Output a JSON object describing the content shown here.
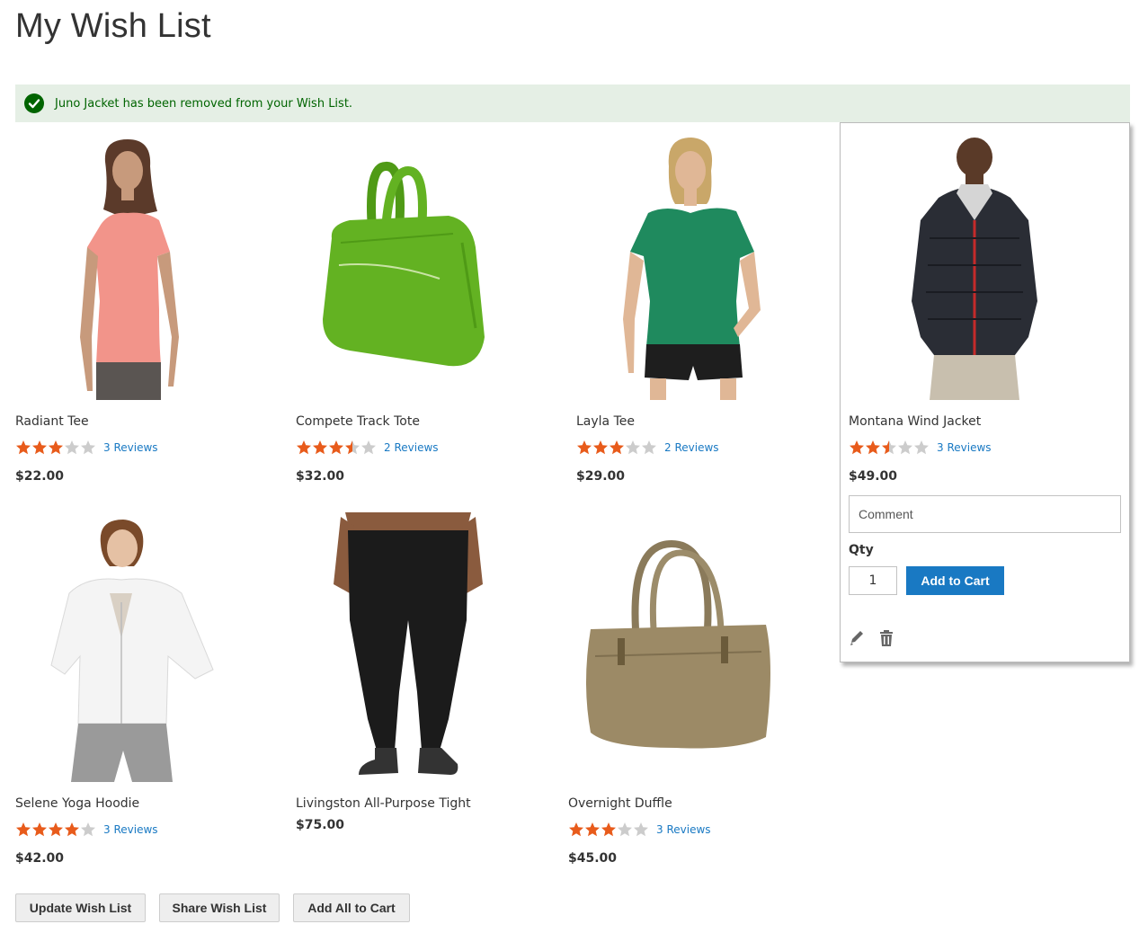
{
  "page_title": "My Wish List",
  "message": "Juno Jacket has been removed from your Wish List.",
  "products": [
    {
      "name": "Radiant Tee",
      "rating_stars": 3,
      "reviews": "3 Reviews",
      "price": "$22.00"
    },
    {
      "name": "Compete Track Tote",
      "rating_stars": 3.5,
      "reviews": "2 Reviews",
      "price": "$32.00"
    },
    {
      "name": "Layla Tee",
      "rating_stars": 3,
      "reviews": "2 Reviews",
      "price": "$29.00"
    },
    {
      "name": "Montana Wind Jacket",
      "rating_stars": 2.5,
      "reviews": "3 Reviews",
      "price": "$49.00"
    },
    {
      "name": "Selene Yoga Hoodie",
      "rating_stars": 4,
      "reviews": "3 Reviews",
      "price": "$42.00"
    },
    {
      "name": "Livingston All-Purpose Tight",
      "price": "$75.00"
    },
    {
      "name": "Overnight Duffle",
      "rating_stars": 3,
      "reviews": "3 Reviews",
      "price": "$45.00"
    }
  ],
  "hover_item": {
    "comment_placeholder": "Comment",
    "qty_label": "Qty",
    "qty_value": "1",
    "add_to_cart": "Add to Cart"
  },
  "actions": {
    "update": "Update Wish List",
    "share": "Share Wish List",
    "add_all": "Add All to Cart"
  },
  "colors": {
    "accent": "#1979c3",
    "star": "#e85b1b",
    "star_empty": "#cccccc",
    "success_bg": "#e5efe5",
    "success_text": "#006400"
  }
}
